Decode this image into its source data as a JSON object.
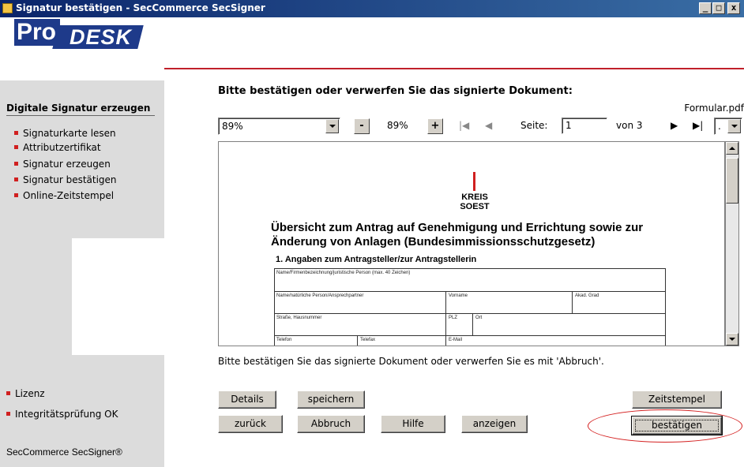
{
  "window": {
    "title": "Signatur bestätigen - SecCommerce SecSigner",
    "controls": {
      "minimize": "_",
      "maximize": "□",
      "close": "x"
    }
  },
  "logo": {
    "part1": "Pro",
    "part2": "DESK"
  },
  "sidebar": {
    "heading": "Digitale Signatur erzeugen",
    "items": [
      {
        "label": "Signaturkarte lesen"
      },
      {
        "label": "Attributzertifikat"
      },
      {
        "label": "Signatur erzeugen"
      },
      {
        "label": "Signatur bestätigen"
      },
      {
        "label": "Online-Zeitstempel"
      }
    ],
    "footer_items": [
      {
        "label": "Lizenz"
      },
      {
        "label": "Integritätsprüfung OK"
      }
    ],
    "brand": "SecCommerce SecSigner®"
  },
  "main": {
    "heading": "Bitte bestätigen oder verwerfen Sie das signierte Dokument:",
    "file_name": "Formular.pdf",
    "status_message": "Bitte bestätigen Sie das signierte Dokument oder verwerfen Sie es mit 'Abbruch'."
  },
  "viewer_toolbar": {
    "zoom_select": "89%",
    "zoom_out": "-",
    "zoom_value": "89%",
    "zoom_in": "+",
    "first_page": "|◀",
    "prev_page": "◀",
    "page_label": "Seite:",
    "page_value": "1",
    "page_of": "von 3",
    "next_page": "▶",
    "last_page": "▶|",
    "extra_select": "."
  },
  "document": {
    "logo_text_1": "KREIS",
    "logo_text_2": "SOEST",
    "title": "Übersicht zum Antrag auf Genehmigung und Errichtung sowie zur Änderung von Anlagen (Bundesimmissionsschutzgesetz)",
    "subheading": "1.  Angaben zum Antragsteller/zur Antragstellerin",
    "form_labels": {
      "name_firm": "Name/Firmenbezeichnung/juristische Person (max. 40 Zeichen)",
      "name_person": "Name/natürliche Person/Ansprechpartner",
      "vorname": "Vorname",
      "akad_grad": "Akad. Grad",
      "strasse": "Straße, Hausnummer",
      "plz": "PLZ",
      "ort": "Ort",
      "telefon": "Telefon",
      "telefax": "Telefax",
      "email": "E-Mail"
    }
  },
  "buttons": {
    "details": "Details",
    "speichern": "speichern",
    "zeitstempel": "Zeitstempel",
    "zurueck": "zurück",
    "abbruch": "Abbruch",
    "hilfe": "Hilfe",
    "anzeigen": "anzeigen",
    "bestaetigen": "bestätigen"
  },
  "colors": {
    "titlebar_start": "#0a246a",
    "titlebar_end": "#3a6ea5",
    "accent_red": "#c0202a",
    "sidebar_bg": "#dcdcdc",
    "button_face": "#d4d0c8",
    "logo_blue": "#1e3a8a"
  }
}
